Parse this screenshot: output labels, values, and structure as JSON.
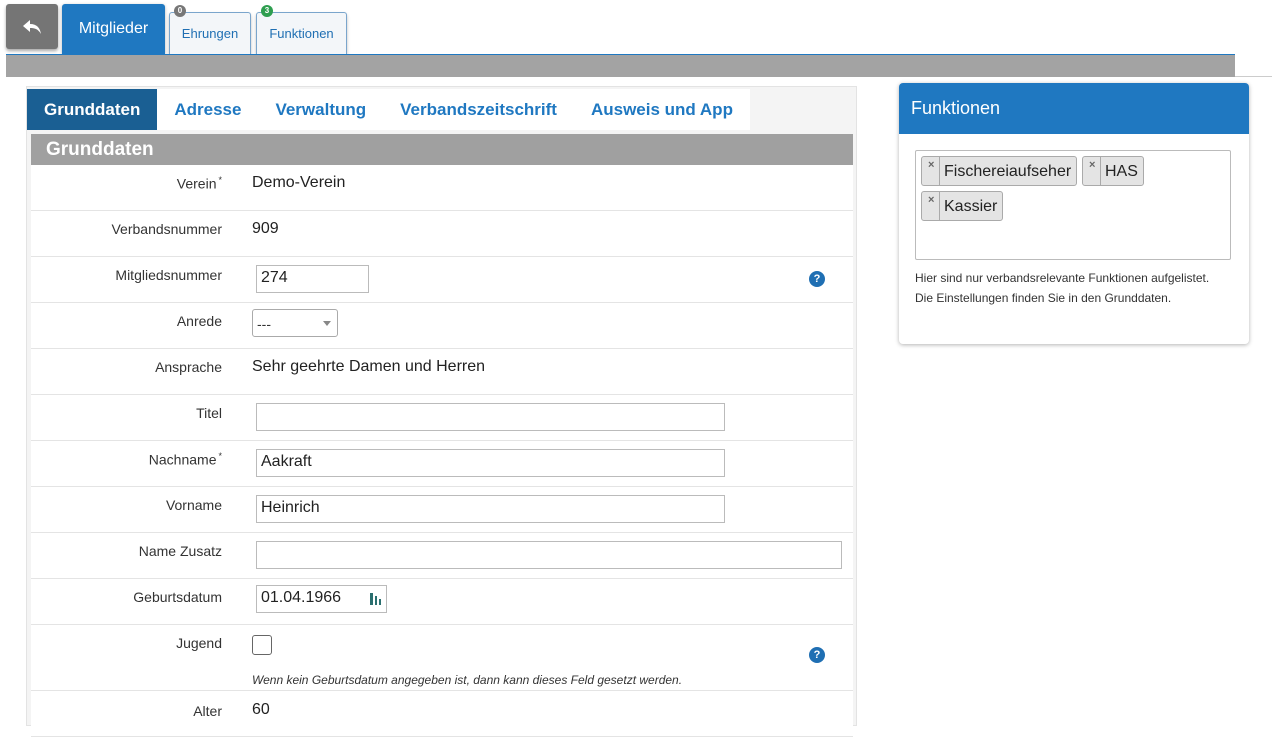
{
  "top_nav": {
    "main_tab": "Mitglieder",
    "tabs": [
      {
        "label": "Ehrungen",
        "badge": "0",
        "badge_color": "#777777"
      },
      {
        "label": "Funktionen",
        "badge": "3",
        "badge_color": "#2e9e4f"
      }
    ]
  },
  "subtabs": [
    "Grunddaten",
    "Adresse",
    "Verwaltung",
    "Verbandszeitschrift",
    "Ausweis und App"
  ],
  "section_title": "Grunddaten",
  "fields": {
    "verein": {
      "label": "Verein",
      "required": "*",
      "value": "Demo-Verein"
    },
    "verbandsnummer": {
      "label": "Verbandsnummer",
      "value": "909"
    },
    "mitgliedsnummer": {
      "label": "Mitgliedsnummer",
      "value": "274"
    },
    "anrede": {
      "label": "Anrede",
      "value": "---"
    },
    "ansprache": {
      "label": "Ansprache",
      "value": "Sehr geehrte Damen und Herren"
    },
    "titel": {
      "label": "Titel",
      "value": ""
    },
    "nachname": {
      "label": "Nachname",
      "required": "*",
      "value": "Aakraft"
    },
    "vorname": {
      "label": "Vorname",
      "value": "Heinrich"
    },
    "name_zusatz": {
      "label": "Name Zusatz",
      "value": ""
    },
    "geburtsdatum": {
      "label": "Geburtsdatum",
      "value": "01.04.1966"
    },
    "jugend": {
      "label": "Jugend",
      "hint": "Wenn kein Geburtsdatum angegeben ist, dann kann dieses Feld gesetzt werden."
    },
    "alter": {
      "label": "Alter",
      "value": "60"
    }
  },
  "help_symbol": "?",
  "side_panel": {
    "title": "Funktionen",
    "tags": [
      "Fischereiaufseher",
      "HAS",
      "Kassier"
    ],
    "note": "Hier sind nur verbandsrelevante Funktionen aufgelistet. Die Einstellungen finden Sie in den Grunddaten."
  },
  "colors": {
    "primary": "#1f78c1",
    "active_subtab": "#1a5f93",
    "section_gray": "#a0a0a0"
  },
  "icons": {
    "back": "reply-icon",
    "calendar": "calendar-icon",
    "remove": "close-icon",
    "help": "help-icon"
  }
}
